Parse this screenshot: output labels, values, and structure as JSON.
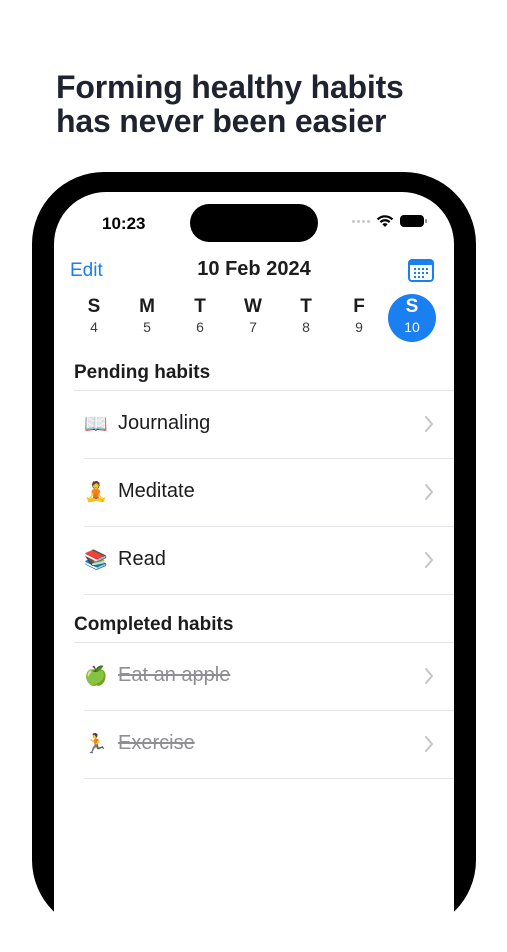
{
  "headline": {
    "line1": "Forming healthy habits",
    "line2": "has never been easier"
  },
  "status_bar": {
    "time": "10:23"
  },
  "nav": {
    "edit_label": "Edit",
    "title": "10 Feb 2024",
    "calendar_icon": "calendar-icon"
  },
  "week": [
    {
      "letter": "S",
      "number": "4",
      "selected": false
    },
    {
      "letter": "M",
      "number": "5",
      "selected": false
    },
    {
      "letter": "T",
      "number": "6",
      "selected": false
    },
    {
      "letter": "W",
      "number": "7",
      "selected": false
    },
    {
      "letter": "T",
      "number": "8",
      "selected": false
    },
    {
      "letter": "F",
      "number": "9",
      "selected": false
    },
    {
      "letter": "S",
      "number": "10",
      "selected": true
    }
  ],
  "pending": {
    "header": "Pending habits",
    "items": [
      {
        "emoji": "📖",
        "icon": "book-icon",
        "label": "Journaling"
      },
      {
        "emoji": "🧘",
        "icon": "meditation-icon",
        "label": "Meditate"
      },
      {
        "emoji": "📚",
        "icon": "books-icon",
        "label": "Read"
      }
    ]
  },
  "completed": {
    "header": "Completed habits",
    "items": [
      {
        "emoji": "🍏",
        "icon": "apple-icon",
        "label": "Eat an apple"
      },
      {
        "emoji": "🏃",
        "icon": "runner-icon",
        "label": "Exercise"
      }
    ]
  },
  "colors": {
    "accent": "#1a7ff0",
    "headline": "#1f2330",
    "completed_text": "#8e8e93",
    "separator": "#e5e5ea"
  }
}
